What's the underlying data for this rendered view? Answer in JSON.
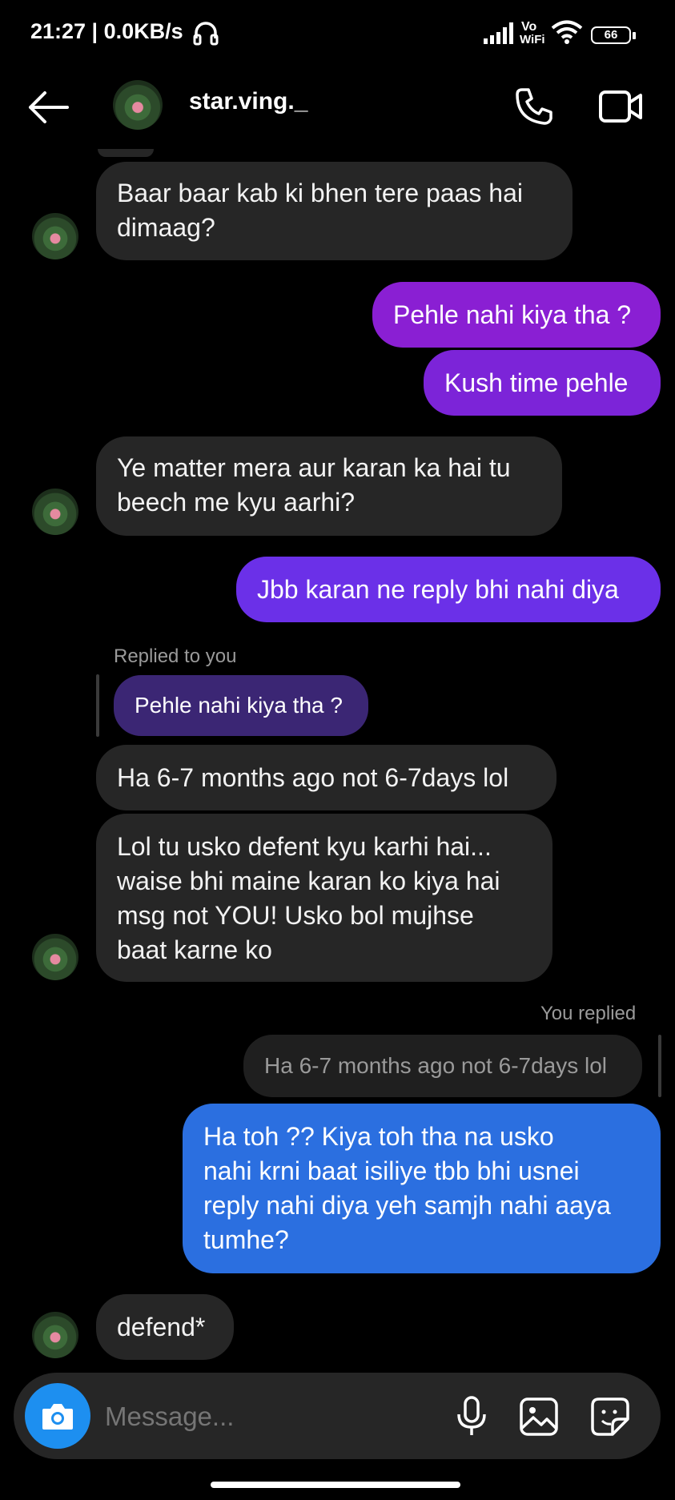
{
  "status_bar": {
    "time_speed": "21:27 | 0.0KB/s",
    "vo_top": "Vo",
    "vo_bottom": "WiFi",
    "battery": "66"
  },
  "header": {
    "username": "star.ving._"
  },
  "messages": {
    "m1": {
      "line1": "Baar baar kab ki bhen tere paas hai",
      "line2": "dimaag?"
    },
    "m2": "Pehle nahi kiya tha ?",
    "m3": "Kush time pehle",
    "m4": {
      "line1": "Ye matter mera aur karan ka hai tu",
      "line2": "beech me kyu aarhi?"
    },
    "m5": "Jbb karan ne reply bhi nahi diya",
    "reply1_label": "Replied to you",
    "reply1_quote": "Pehle nahi kiya tha ?",
    "m6": "Ha 6-7 months ago not 6-7days lol",
    "m7": {
      "line1": "Lol tu usko defent kyu karhi hai...",
      "line2": "waise bhi maine karan ko kiya hai",
      "line3": "msg not YOU! Usko bol mujhse",
      "line4": "baat karne ko"
    },
    "reply2_label": "You replied",
    "reply2_quote": "Ha 6-7 months ago not 6-7days lol",
    "m8": {
      "line1": "Ha toh ?? Kiya toh tha na usko",
      "line2": "nahi krni baat isiliye tbb bhi usnei",
      "line3": "reply nahi diya yeh samjh nahi aaya",
      "line4": "tumhe?"
    },
    "m9": "defend*"
  },
  "composer": {
    "placeholder": "Message..."
  },
  "icons": {
    "back": "back-arrow-icon",
    "call": "phone-icon",
    "video": "video-camera-icon",
    "camera": "camera-icon",
    "mic": "microphone-icon",
    "gallery": "gallery-icon",
    "sticker": "sticker-icon"
  },
  "colors": {
    "background": "#000000",
    "incoming": "#262626",
    "outgoing_purple": "#8a1fd3",
    "outgoing_violet": "#6b30e8",
    "outgoing_blue": "#2b6fe0",
    "camera_button": "#1d8ff0"
  }
}
